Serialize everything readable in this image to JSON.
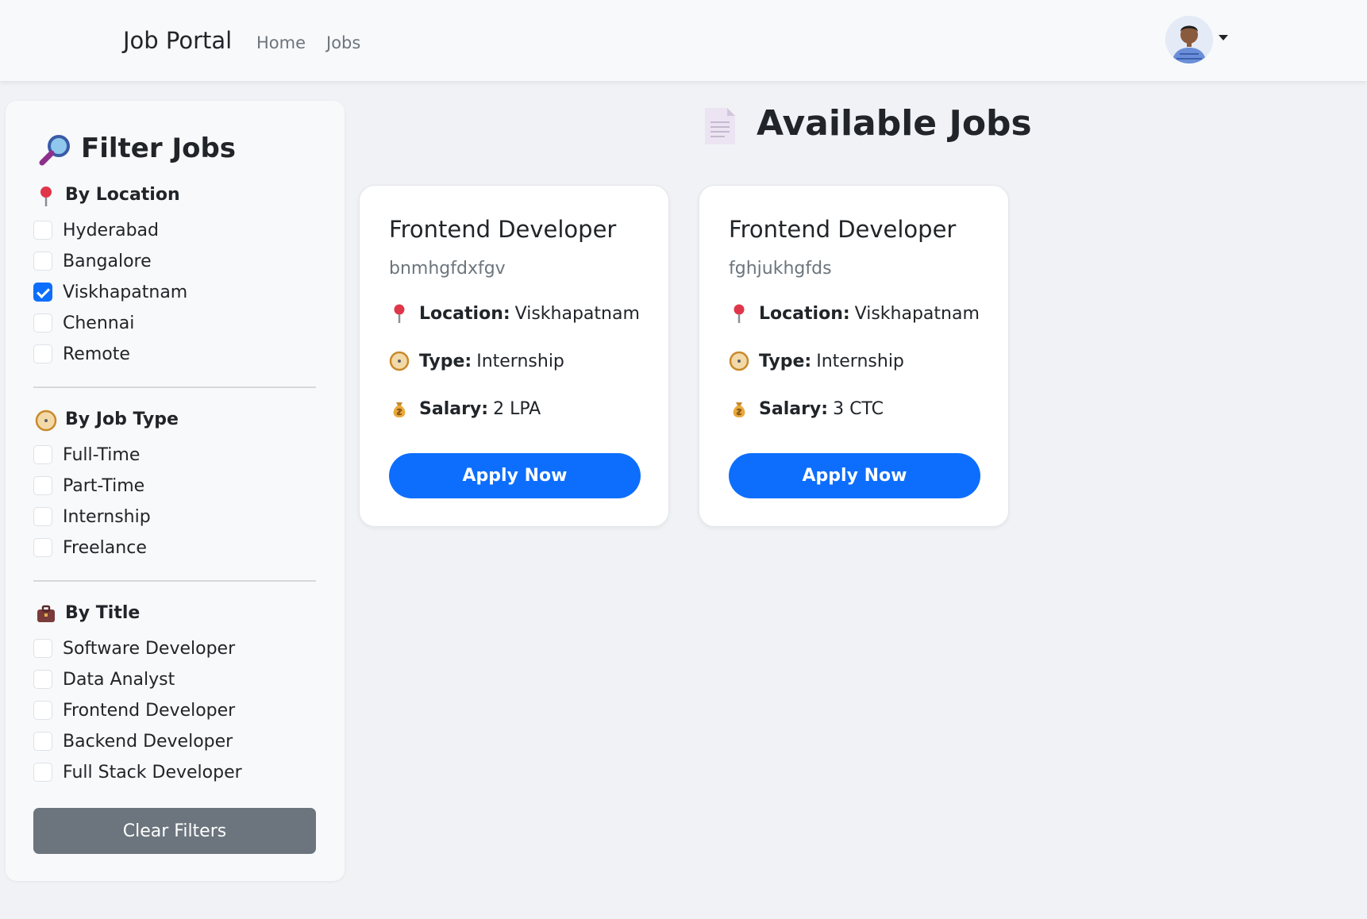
{
  "navbar": {
    "brand": "Job Portal",
    "links": [
      "Home",
      "Jobs"
    ]
  },
  "sidebar": {
    "title": "Filter Jobs",
    "groups": [
      {
        "heading": "By Location",
        "icon": "pushpin-icon",
        "options": [
          {
            "label": "Hyderabad",
            "checked": false
          },
          {
            "label": "Bangalore",
            "checked": false
          },
          {
            "label": "Viskhapatnam",
            "checked": true
          },
          {
            "label": "Chennai",
            "checked": false
          },
          {
            "label": "Remote",
            "checked": false
          }
        ]
      },
      {
        "heading": "By Job Type",
        "icon": "compass-icon",
        "options": [
          {
            "label": "Full-Time",
            "checked": false
          },
          {
            "label": "Part-Time",
            "checked": false
          },
          {
            "label": "Internship",
            "checked": false
          },
          {
            "label": "Freelance",
            "checked": false
          }
        ]
      },
      {
        "heading": "By Title",
        "icon": "briefcase-icon",
        "options": [
          {
            "label": "Software Developer",
            "checked": false
          },
          {
            "label": "Data Analyst",
            "checked": false
          },
          {
            "label": "Frontend Developer",
            "checked": false
          },
          {
            "label": "Backend Developer",
            "checked": false
          },
          {
            "label": "Full Stack Developer",
            "checked": false
          }
        ]
      }
    ],
    "clear_label": "Clear Filters"
  },
  "main": {
    "title": "Available Jobs",
    "jobs": [
      {
        "title": "Frontend Developer",
        "company": "bnmhgfdxfgv",
        "location_key": "Location:",
        "location": "Viskhapatnam",
        "type_key": "Type:",
        "type": "Internship",
        "salary_key": "Salary:",
        "salary": "2 LPA",
        "apply_label": "Apply Now"
      },
      {
        "title": "Frontend Developer",
        "company": "fghjukhgfds",
        "location_key": "Location:",
        "location": "Viskhapatnam",
        "type_key": "Type:",
        "type": "Internship",
        "salary_key": "Salary:",
        "salary": "3 CTC",
        "apply_label": "Apply Now"
      }
    ]
  },
  "colors": {
    "primary": "#0d6efd",
    "secondary": "#6c757d",
    "background": "#f0f2f5"
  }
}
